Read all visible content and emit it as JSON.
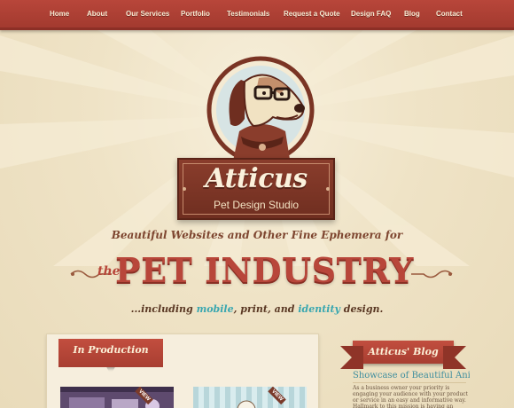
{
  "nav": {
    "items": [
      {
        "label": "Home"
      },
      {
        "label": "About"
      },
      {
        "label": "Our Services"
      },
      {
        "label": "Portfolio"
      },
      {
        "label": "Testimonials"
      },
      {
        "label": "Request a Quote"
      },
      {
        "label": "Design FAQ"
      },
      {
        "label": "Blog"
      },
      {
        "label": "Contact"
      }
    ]
  },
  "logo": {
    "title": "Atticus",
    "subtitle": "Pet Design Studio"
  },
  "tagline": {
    "line1": "Beautiful Websites and Other Fine Ephemera for",
    "the": "the",
    "headline": "PET INDUSTRY",
    "line3_prefix": "...including ",
    "line3_mobile": "mobile",
    "line3_mid": ", print, and ",
    "line3_identity": "identity",
    "line3_suffix": " design."
  },
  "production": {
    "heading": "In Production",
    "view_label": "VIEW"
  },
  "blog": {
    "heading": "Atticus' Blog",
    "post_title": "Showcase of Beautiful Animal W...",
    "post_excerpt": "As a business owner your priority is engaging your audience with your product or service in an easy and informative way. Hallmark to this mission is having an attractive website that makes"
  },
  "colors": {
    "brand_red": "#b8463a",
    "accent_teal": "#3aa7b0",
    "plaque_brown": "#7a3424",
    "cream": "#efe3c6"
  }
}
